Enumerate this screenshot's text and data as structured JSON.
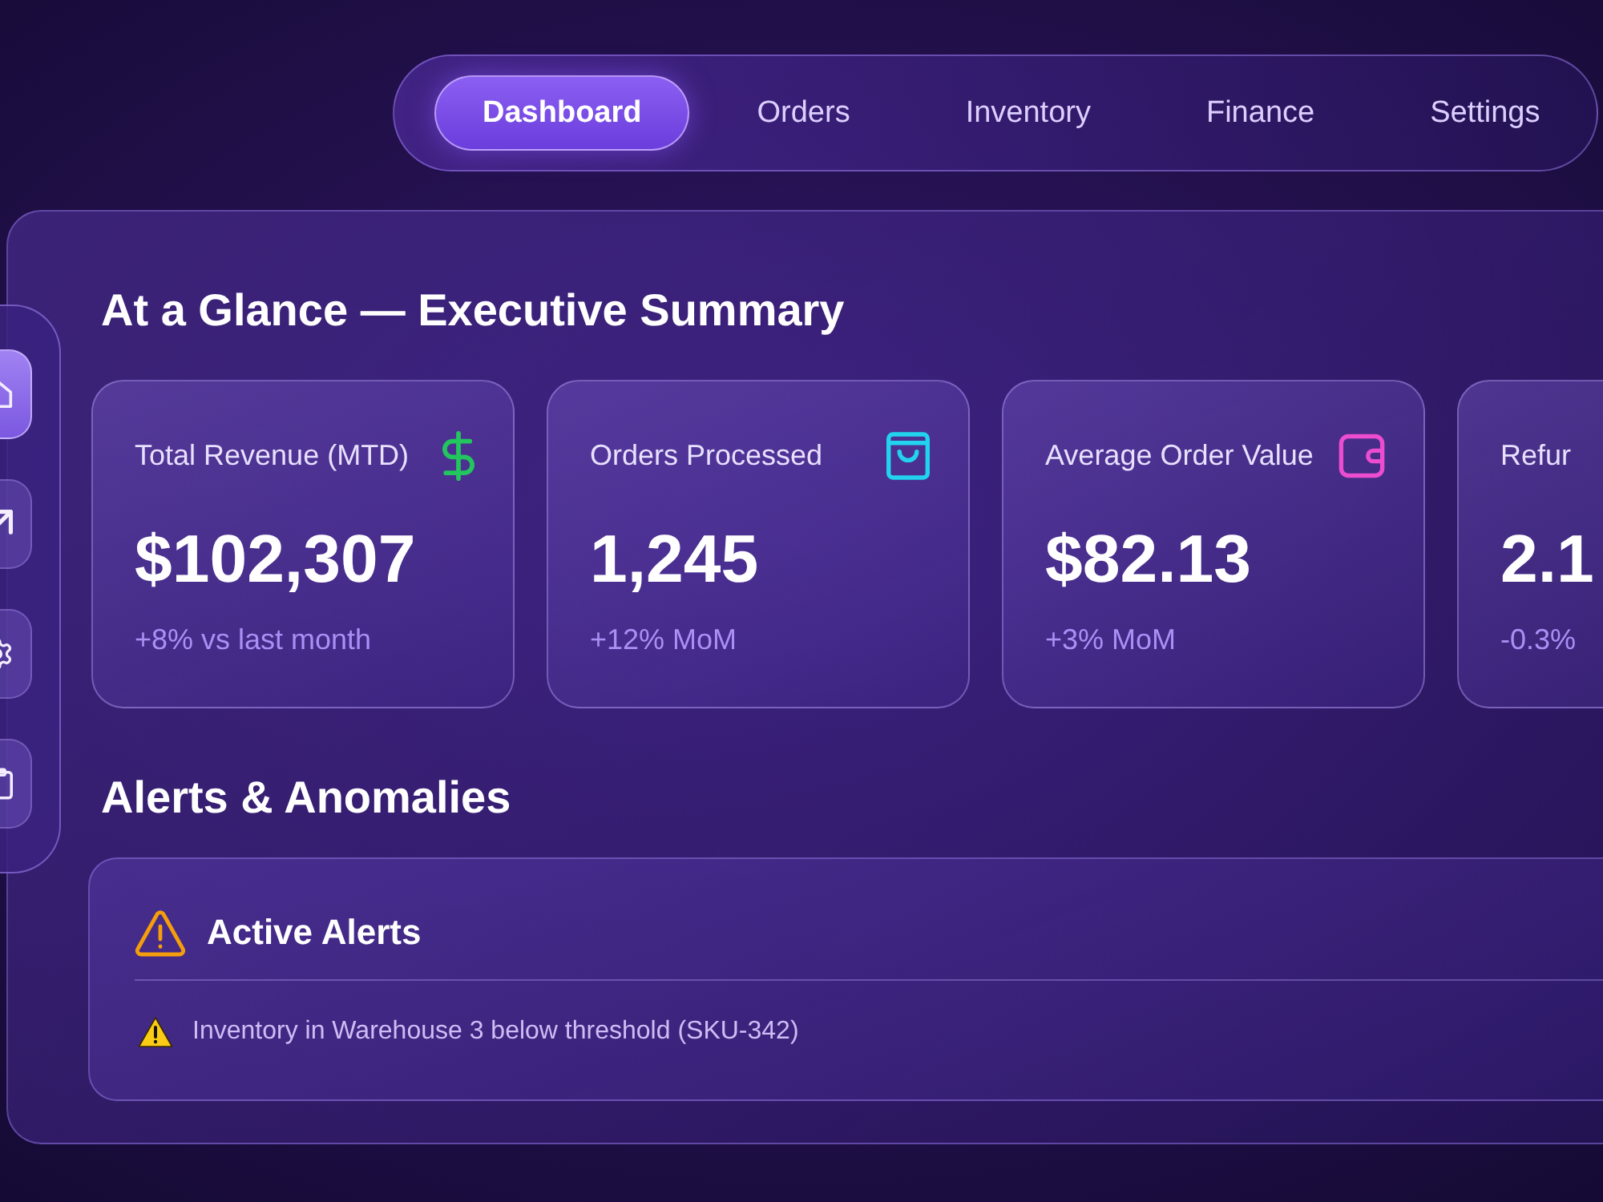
{
  "nav": {
    "tabs": [
      {
        "label": "Dashboard",
        "selected": true
      },
      {
        "label": "Orders",
        "selected": false
      },
      {
        "label": "Inventory",
        "selected": false
      },
      {
        "label": "Finance",
        "selected": false
      },
      {
        "label": "Settings",
        "selected": false
      }
    ]
  },
  "sidebar": {
    "items": [
      {
        "selected": true
      },
      {
        "selected": false
      },
      {
        "selected": false
      },
      {
        "selected": false
      }
    ]
  },
  "summary": {
    "title": "At a Glance — Executive Summary",
    "cards": [
      {
        "label": "Total Revenue (MTD)",
        "value": "$102,307",
        "change": "+8% vs last month",
        "color": "#22c55e"
      },
      {
        "label": "Orders Processed",
        "value": "1,245",
        "change": "+12% MoM",
        "color": "#22d3ee"
      },
      {
        "label": "Average Order Value",
        "value": "$82.13",
        "change": "+3% MoM",
        "color": "#ec4dd0"
      },
      {
        "label": "Refur",
        "value": "2.1",
        "change": "-0.3%"
      }
    ]
  },
  "alerts": {
    "title": "Alerts & Anomalies",
    "panel": {
      "title": "Active Alerts",
      "items": [
        "Inventory in Warehouse 3 below threshold (SKU-342)"
      ]
    }
  }
}
